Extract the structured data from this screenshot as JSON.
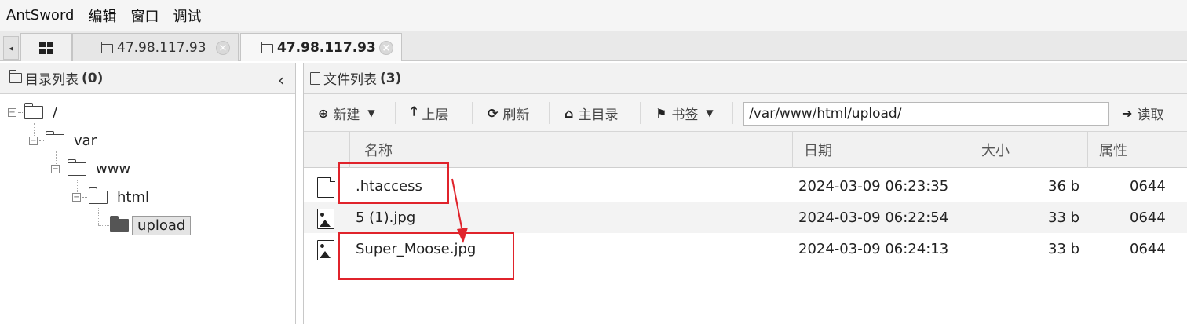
{
  "menu": [
    "AntSword",
    "编辑",
    "窗口",
    "调试"
  ],
  "tabs": {
    "scroll_left": "◂",
    "tab1_label": "47.98.117.93",
    "tab2_label": "47.98.117.93",
    "close_glyph": "⊗"
  },
  "dir_panel": {
    "title": "目录列表",
    "count": "(0)",
    "collapse_glyph": "‹",
    "tree": [
      "/",
      "var",
      "www",
      "html",
      "upload"
    ]
  },
  "file_panel": {
    "title": "文件列表",
    "count": "(3)"
  },
  "toolbar": {
    "new_label": "新建",
    "up_label": "上层",
    "refresh_label": "刷新",
    "home_label": "主目录",
    "bookmark_label": "书签",
    "path_value": "/var/www/html/upload/",
    "read_label": "读取"
  },
  "grid": {
    "columns": [
      "名称",
      "日期",
      "大小",
      "属性"
    ],
    "rows": [
      {
        "icon": "file-icon",
        "name": ".htaccess",
        "date": "2024-03-09 06:23:35",
        "size": "36 b",
        "attr": "0644"
      },
      {
        "icon": "image-file-icon",
        "name": "5 (1).jpg",
        "date": "2024-03-09 06:22:54",
        "size": "33 b",
        "attr": "0644"
      },
      {
        "icon": "image-file-icon",
        "name": "Super_Moose.jpg",
        "date": "2024-03-09 06:24:13",
        "size": "33 b",
        "attr": "0644"
      }
    ]
  },
  "colors": {
    "annotation": "#e0232b"
  }
}
